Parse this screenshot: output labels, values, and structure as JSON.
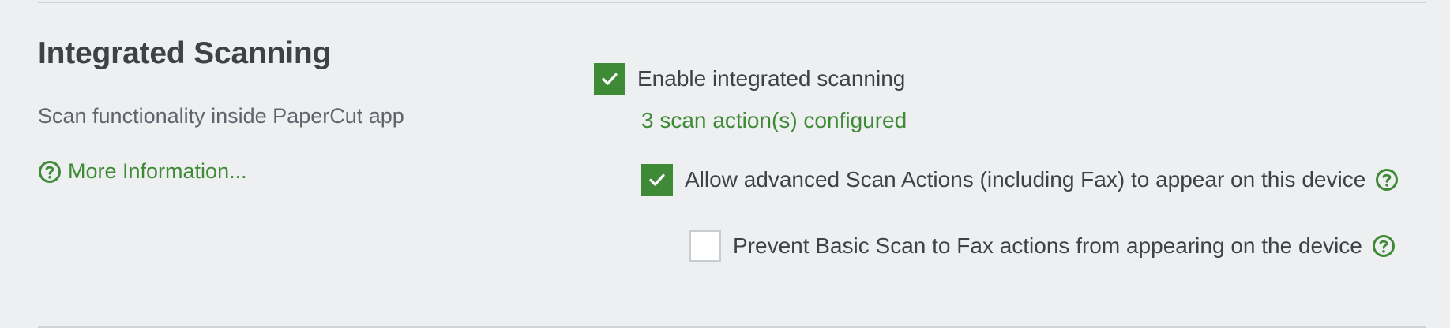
{
  "section": {
    "title": "Integrated Scanning",
    "description": "Scan functionality inside PaperCut app",
    "more_info_label": "More Information..."
  },
  "options": {
    "enable_scanning": {
      "label": "Enable integrated scanning",
      "checked": true,
      "configured_text": "3 scan action(s) configured"
    },
    "allow_advanced": {
      "label": "Allow advanced Scan Actions (including Fax) to appear on this device",
      "checked": true
    },
    "prevent_basic_fax": {
      "label": "Prevent Basic Scan to Fax actions from appearing on the device",
      "checked": false
    }
  },
  "icons": {
    "help": "question-circle-icon",
    "check": "checkmark-icon"
  },
  "colors": {
    "accent": "#3f8a37",
    "background": "#eeeff1",
    "text": "#3d4247",
    "muted_text": "#5d646b"
  }
}
